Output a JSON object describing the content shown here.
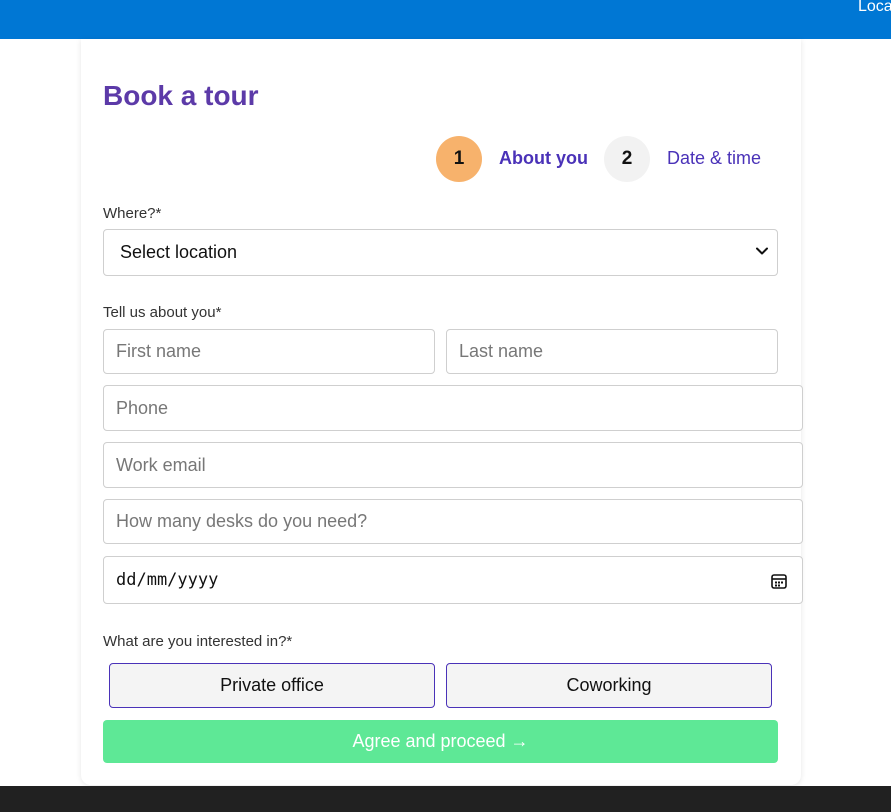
{
  "header": {
    "nav_link": "Loca"
  },
  "form": {
    "title": "Book a tour",
    "steps": [
      {
        "number": "1",
        "label": "About you",
        "active": true
      },
      {
        "number": "2",
        "label": "Date & time",
        "active": false
      }
    ],
    "location": {
      "label": "Where?*",
      "selected": "Select location"
    },
    "about": {
      "label": "Tell us about you*",
      "first_name_placeholder": "First name",
      "last_name_placeholder": "Last name",
      "phone_placeholder": "Phone",
      "email_placeholder": "Work email",
      "desks_placeholder": "How many desks do you need?",
      "date_placeholder": "dd/mm/yyyy"
    },
    "interest": {
      "label": "What are you interested in?*",
      "options": [
        "Private office",
        "Coworking"
      ]
    },
    "submit_label": "Agree and proceed →"
  },
  "colors": {
    "header_bg": "#0077d4",
    "title": "#5c3aa8",
    "step_active": "#f7b26c",
    "step_inactive": "#f2f2f2",
    "step_text": "#4a32b8",
    "submit_bg": "#5ee896",
    "footer_bg": "#212121"
  },
  "icons": {
    "select": "chevron-down-icon",
    "date": "calendar-icon"
  }
}
